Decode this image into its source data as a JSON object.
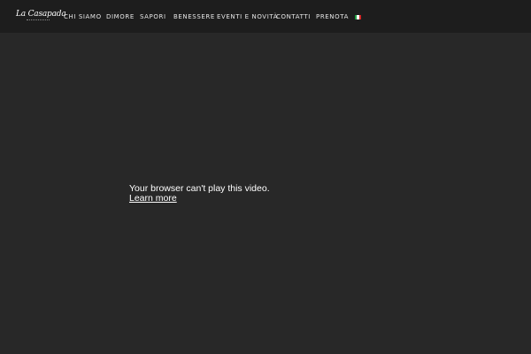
{
  "header": {
    "logo_text": "La Casapada",
    "nav": [
      "CHI SIAMO",
      "DIMORE",
      "SAPORI",
      "BENESSERE",
      "EVENTI E NOVITÀ",
      "CONTATTI",
      "PRENOTA"
    ],
    "flag_colors": [
      "#1f9d3f",
      "#ffffff",
      "#d32b2b"
    ]
  },
  "video": {
    "message": "Your browser can't play this video.",
    "link": "Learn more"
  },
  "colors": {
    "header_bg": "#1d1d1d",
    "page_bg": "#282828",
    "text": "#ffffff"
  }
}
